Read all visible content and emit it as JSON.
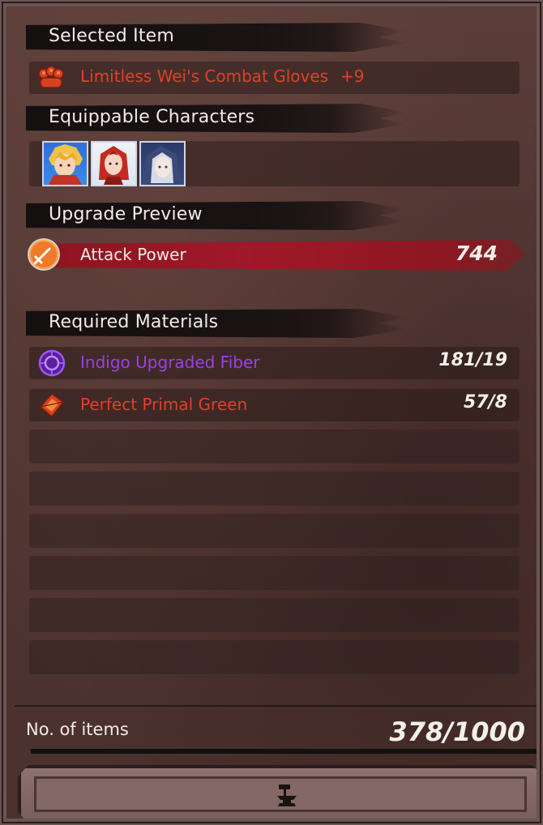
{
  "sections": {
    "selected_item": "Selected Item",
    "equippable_characters": "Equippable Characters",
    "upgrade_preview": "Upgrade Preview",
    "required_materials": "Required Materials"
  },
  "selected_item": {
    "name": "Limitless Wei's Combat Gloves",
    "level": "+9",
    "icon": "gloves-icon",
    "color": "#e0402a"
  },
  "characters": [
    {
      "icon": "blonde-hero-portrait"
    },
    {
      "icon": "red-haired-heroine-portrait"
    },
    {
      "icon": "hooded-silver-hair-portrait"
    }
  ],
  "upgrade_preview": {
    "stat_label": "Attack Power",
    "stat_value": "744",
    "icon": "sword-icon"
  },
  "materials": [
    {
      "name": "Indigo Upgraded Fiber",
      "qty": "181/19",
      "color": "#9a40e8",
      "icon": "fiber-rune-icon"
    },
    {
      "name": "Perfect Primal Green",
      "qty": "57/8",
      "color": "#e0402a",
      "icon": "primal-crystal-icon"
    }
  ],
  "footer": {
    "count_label": "No. of items",
    "count_value": "378/1000",
    "button_icon": "anvil-hammer-icon"
  }
}
